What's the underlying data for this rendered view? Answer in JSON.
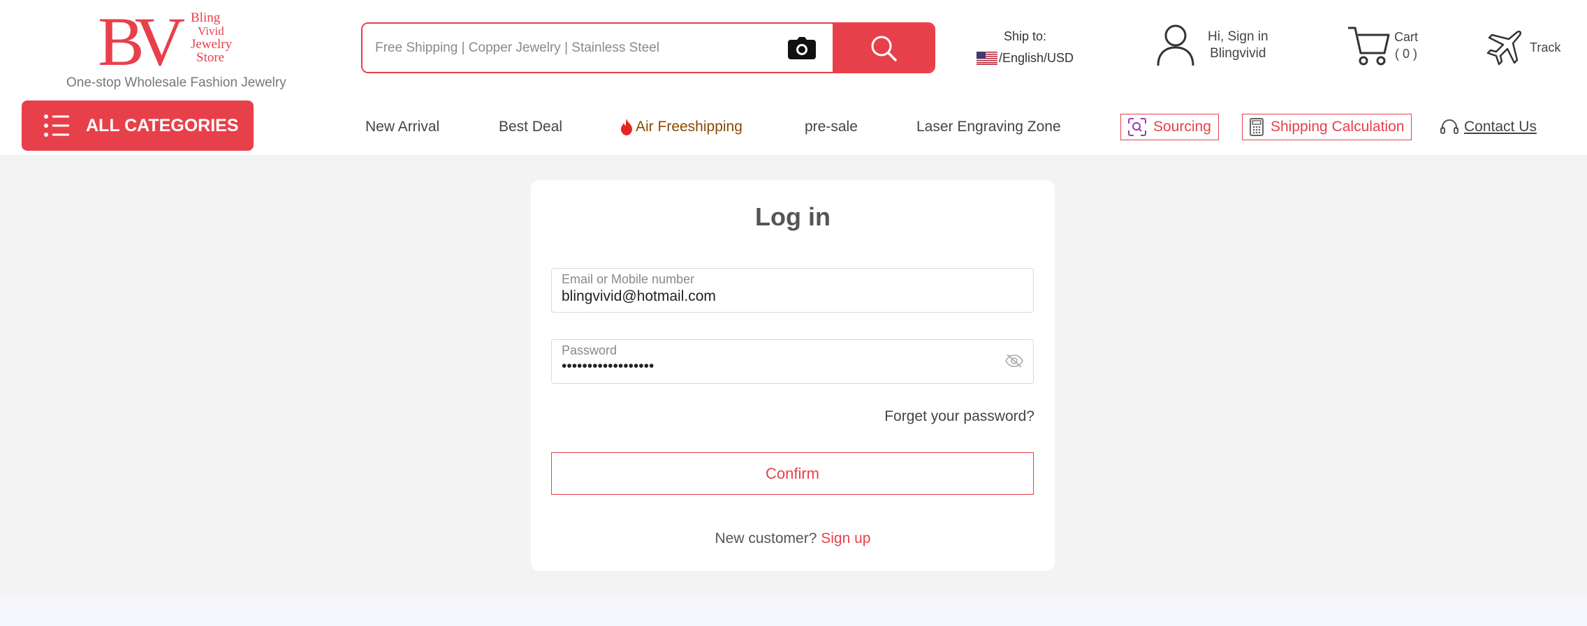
{
  "logo": {
    "letters": "BV",
    "words": [
      "Bling",
      "Vivid",
      "Jewelry",
      "Store"
    ],
    "tagline": "One-stop Wholesale Fashion Jewelry"
  },
  "search": {
    "placeholder": "Free Shipping | Copper Jewelry | Stainless Steel"
  },
  "ship_to": {
    "label": "Ship to:",
    "value": "/English/USD"
  },
  "account": {
    "line1": "Hi, Sign in",
    "line2": "Blingvivid"
  },
  "cart": {
    "label": "Cart",
    "count": "( 0 )"
  },
  "track": {
    "label": "Track"
  },
  "nav": {
    "all_categories": "ALL CATEGORIES",
    "new_arrival": "New Arrival",
    "best_deal": "Best Deal",
    "air_freeshipping": "Air Freeshipping",
    "pre_sale": "pre-sale",
    "laser_engraving": "Laser Engraving Zone",
    "sourcing": "Sourcing",
    "shipping_calc": "Shipping Calculation",
    "contact_us": "Contact Us"
  },
  "login": {
    "title": "Log in",
    "email_label": "Email or Mobile number",
    "email_value": "blingvivid@hotmail.com",
    "password_label": "Password",
    "password_value": "••••••••••••••••••",
    "forgot": "Forget your password?",
    "confirm": "Confirm",
    "new_customer": "New customer?",
    "sign_up": "Sign up"
  },
  "colors": {
    "accent": "#e8404a",
    "background": "#f3f3f3"
  }
}
